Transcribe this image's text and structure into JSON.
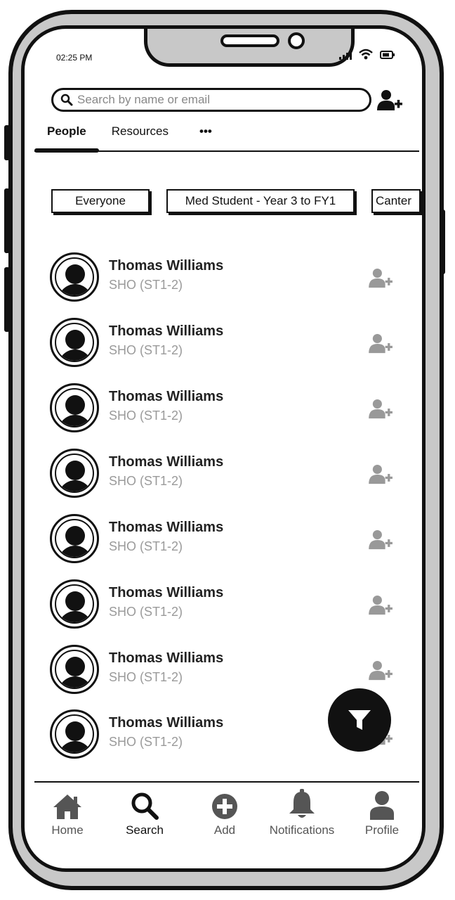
{
  "status_bar": {
    "time": "02:25 PM"
  },
  "search": {
    "placeholder": "Search by name or email"
  },
  "tabs": [
    {
      "label": "People",
      "active": true
    },
    {
      "label": "Resources",
      "active": false
    },
    {
      "label": "•••",
      "active": false
    }
  ],
  "filters": [
    {
      "label": "Everyone"
    },
    {
      "label": "Med Student - Year 3 to FY1"
    },
    {
      "label": "Canter"
    }
  ],
  "people": [
    {
      "name": "Thomas Williams",
      "role": "SHO (ST1-2)"
    },
    {
      "name": "Thomas Williams",
      "role": "SHO (ST1-2)"
    },
    {
      "name": "Thomas Williams",
      "role": "SHO (ST1-2)"
    },
    {
      "name": "Thomas Williams",
      "role": "SHO (ST1-2)"
    },
    {
      "name": "Thomas Williams",
      "role": "SHO (ST1-2)"
    },
    {
      "name": "Thomas Williams",
      "role": "SHO (ST1-2)"
    },
    {
      "name": "Thomas Williams",
      "role": "SHO (ST1-2)"
    },
    {
      "name": "Thomas Williams",
      "role": "SHO (ST1-2)"
    }
  ],
  "nav": [
    {
      "label": "Home",
      "icon": "home-icon",
      "active": false
    },
    {
      "label": "Search",
      "icon": "search-icon",
      "active": true
    },
    {
      "label": "Add",
      "icon": "plus-circle-icon",
      "active": false
    },
    {
      "label": "Notifications",
      "icon": "bell-icon",
      "active": false
    },
    {
      "label": "Profile",
      "icon": "user-icon",
      "active": false
    }
  ],
  "colors": {
    "ink": "#111111",
    "muted": "#9a9a9a",
    "frame": "#c8c8c8"
  }
}
